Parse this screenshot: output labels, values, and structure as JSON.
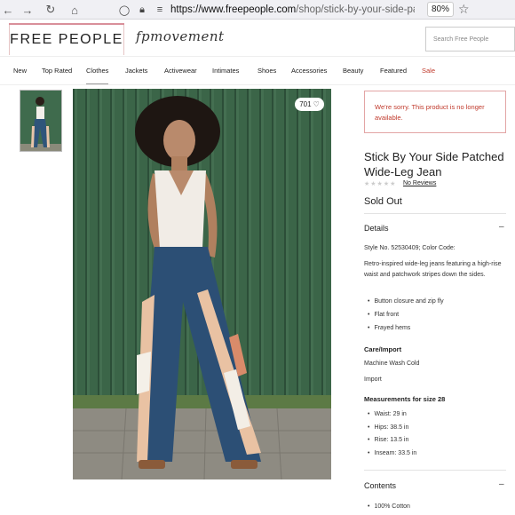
{
  "browser": {
    "back_icon": "back-arrow-icon",
    "forward_icon": "forward-arrow-icon",
    "reload_icon": "reload-icon",
    "home_icon": "home-icon",
    "url_host": "https://www.freepeople.com",
    "url_path": "/shop/stick-by-your-side-patc",
    "zoom": "80%",
    "bookmark_icon": "star-icon"
  },
  "header": {
    "logo": "FREE PEOPLE",
    "movement": "fpmovement",
    "search_placeholder": "Search Free People"
  },
  "nav": {
    "items": [
      "New",
      "Top Rated",
      "Clothes",
      "Jackets",
      "Activewear",
      "Intimates",
      "Shoes",
      "Accessories",
      "Beauty",
      "Featured",
      "Sale"
    ],
    "active": "Clothes"
  },
  "gallery": {
    "like_count": "701"
  },
  "product": {
    "notice": "We're sorry. This product is no longer available.",
    "title": "Stick By Your Side Patched Wide-Leg Jean",
    "reviews": "No Reviews",
    "status": "Sold Out",
    "details_heading": "Details",
    "style_line": "Style No. 52530409; Color Code:",
    "description": "Retro-inspired wide-leg jeans featuring a high-rise waist and patchwork stripes down the sides.",
    "features": [
      "Button closure and zip fly",
      "Flat front",
      "Frayed hems"
    ],
    "care_heading": "Care/Import",
    "care": "Machine Wash Cold",
    "import": "Import",
    "measurements_heading": "Measurements for size 28",
    "measurements": [
      "Waist: 29 in",
      "Hips: 38.5 in",
      "Rise: 13.5 in",
      "Inseam: 33.5 in"
    ],
    "contents_heading": "Contents",
    "contents": [
      "100% Cotton"
    ]
  },
  "colors": {
    "sale": "#c0392b",
    "notice_border": "#e3a5a5",
    "wall_green": "#3a6447"
  }
}
